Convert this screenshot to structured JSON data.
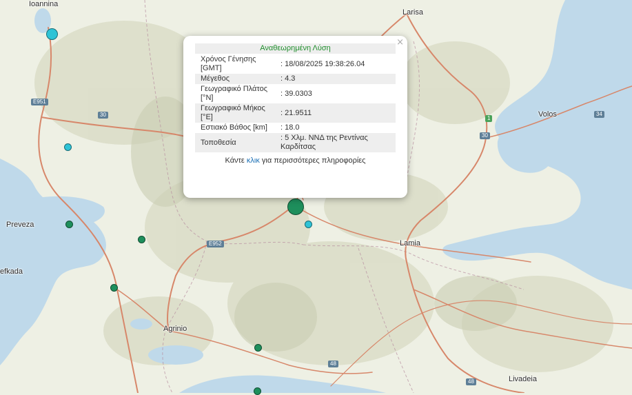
{
  "map": {
    "cities": [
      {
        "key": "ioannina",
        "label": "Ioannina"
      },
      {
        "key": "larisa",
        "label": "Larisa"
      },
      {
        "key": "volos",
        "label": "Volos"
      },
      {
        "key": "preveza",
        "label": "Preveza"
      },
      {
        "key": "lefkada",
        "label": "efkada"
      },
      {
        "key": "lamia",
        "label": "Lamia"
      },
      {
        "key": "agrinio",
        "label": "Agrinio"
      },
      {
        "key": "livadeia",
        "label": "Livadeia"
      }
    ],
    "road_shields": [
      "E951",
      "30",
      "E952",
      "1",
      "30",
      "34",
      "48",
      "48"
    ],
    "colors": {
      "land": "#eef0e4",
      "sea": "#bfd9ea",
      "road": "#d7876a",
      "marker_green": "#1e8f5c",
      "marker_cyan": "#2ec3d6"
    }
  },
  "popup": {
    "title": "Αναθεωρημένη Λύση",
    "close_glyph": "×",
    "rows": [
      {
        "label": "Χρόνος Γένησης [GMT]",
        "value": ": 18/08/2025 19:38:26.04"
      },
      {
        "label": "Μέγεθος",
        "value": ": 4.3"
      },
      {
        "label": "Γεωγραφικό Πλάτος [°N]",
        "value": ": 39.0303"
      },
      {
        "label": "Γεωγραφικό Μήκος [°E]",
        "value": ": 21.9511"
      },
      {
        "label": "Εστιακό Βάθος [km]",
        "value": ": 18.0"
      },
      {
        "label": "Τοποθεσία",
        "value": ": 5 Χλμ. ΝΝΔ της Ρεντίνας Καρδίτσας"
      }
    ],
    "more_prefix": "Κάντε ",
    "more_link": "κλικ",
    "more_suffix": " για περισσότερες πληροφορίες"
  }
}
